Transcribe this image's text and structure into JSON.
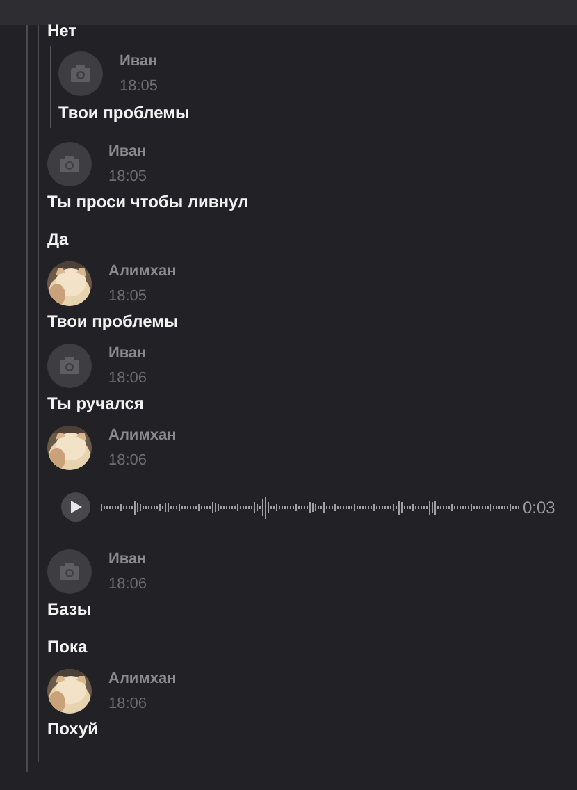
{
  "messages": [
    {
      "kind": "text",
      "text": "Нет"
    },
    {
      "kind": "quote",
      "author": "Иван",
      "time": "18:05",
      "avatar_photo": false,
      "text": "Твои проблемы"
    },
    {
      "kind": "header",
      "author": "Иван",
      "time": "18:05",
      "avatar_photo": false
    },
    {
      "kind": "text",
      "text": "Ты проси чтобы ливнул"
    },
    {
      "kind": "text",
      "text": "Да"
    },
    {
      "kind": "header",
      "author": "Алимхан",
      "time": "18:05",
      "avatar_photo": true
    },
    {
      "kind": "text",
      "text": "Твои проблемы"
    },
    {
      "kind": "header",
      "author": "Иван",
      "time": "18:06",
      "avatar_photo": false
    },
    {
      "kind": "text",
      "text": "Ты ручался"
    },
    {
      "kind": "header",
      "author": "Алимхан",
      "time": "18:06",
      "avatar_photo": true
    },
    {
      "kind": "voice",
      "duration": "0:03"
    },
    {
      "kind": "header",
      "author": "Иван",
      "time": "18:06",
      "avatar_photo": false
    },
    {
      "kind": "text",
      "text": "Базы"
    },
    {
      "kind": "text",
      "text": "Пока"
    },
    {
      "kind": "header",
      "author": "Алимхан",
      "time": "18:06",
      "avatar_photo": true
    },
    {
      "kind": "text",
      "text": "Похуй"
    }
  ]
}
